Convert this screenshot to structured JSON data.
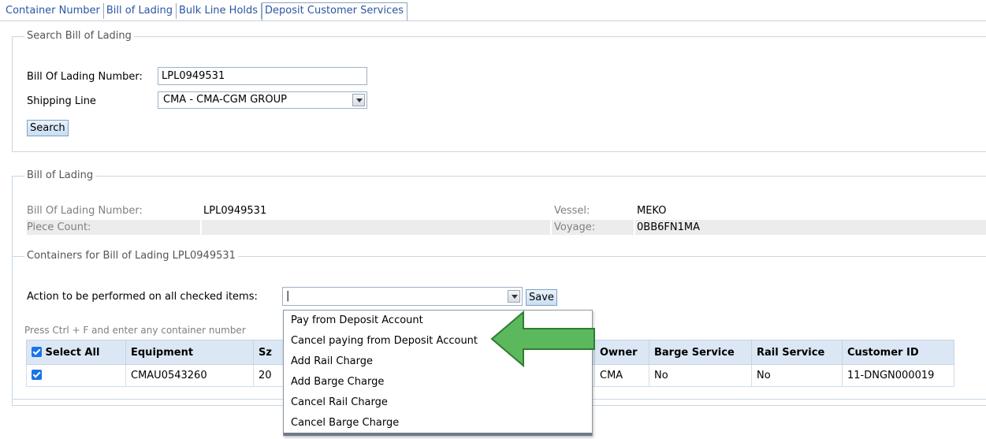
{
  "tabs": [
    "Container Number",
    "Bill of Lading",
    "Bulk Line Holds",
    "Deposit Customer Services"
  ],
  "search_section": {
    "legend": "Search Bill of Lading",
    "bol_label": "Bill Of Lading Number:",
    "bol_value": "LPL0949531",
    "shipping_line_label": "Shipping Line",
    "shipping_line_value": "CMA - CMA-CGM GROUP",
    "search_button": "Search"
  },
  "bol_section": {
    "legend": "Bill of Lading",
    "bol_number_label": "Bill Of Lading Number:",
    "bol_number_value": "LPL0949531",
    "piece_count_label": "Piece Count:",
    "piece_count_value": "",
    "vessel_label": "Vessel:",
    "vessel_value": "MEKO",
    "voyage_label": "Voyage:",
    "voyage_value": "0BB6FN1MA"
  },
  "containers_section": {
    "legend": "Containers for Bill of Lading LPL0949531",
    "action_label": "Action to be performed on all checked items:",
    "action_value": "|",
    "save_button": "Save",
    "hint": "Press Ctrl + F and enter any container number",
    "columns": {
      "select_all": "Select All",
      "equipment": "Equipment",
      "size": "Sz",
      "owner": "Owner",
      "barge_service": "Barge Service",
      "rail_service": "Rail Service",
      "customer_id": "Customer ID"
    },
    "rows": [
      {
        "equipment": "CMAU0543260",
        "size": "20",
        "owner": "CMA",
        "barge_service": "No",
        "rail_service": "No",
        "customer_id": "11-DNGN000019"
      }
    ]
  },
  "action_options": [
    "Pay from Deposit Account",
    "Cancel paying from Deposit Account",
    "Add Rail Charge",
    "Add Barge Charge",
    "Cancel Rail Charge",
    "Cancel Barge Charge"
  ],
  "annotation": {
    "type": "arrow",
    "color": "#5cb85c",
    "border": "#2e7d32",
    "points_to": "Cancel paying from Deposit Account"
  }
}
